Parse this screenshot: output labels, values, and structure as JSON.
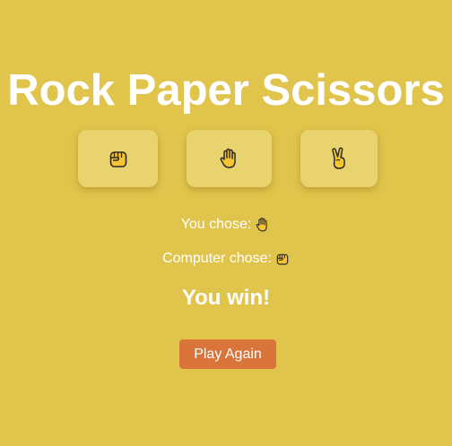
{
  "title": "Rock Paper Scissors",
  "choices": [
    {
      "name": "rock",
      "icon": "raised-fist-icon"
    },
    {
      "name": "paper",
      "icon": "raised-hand-icon"
    },
    {
      "name": "scissors",
      "icon": "victory-hand-icon"
    }
  ],
  "status": {
    "you_label": "You chose:",
    "you_choice_icon": "raised-hand-icon",
    "computer_label": "Computer chose:",
    "computer_choice_icon": "raised-fist-icon",
    "result": "You win!"
  },
  "play_again_label": "Play Again",
  "colors": {
    "background": "#e1c44b",
    "button_bg": "#e8d36f",
    "play_again_bg": "#d9743a",
    "text": "#ffffff"
  }
}
